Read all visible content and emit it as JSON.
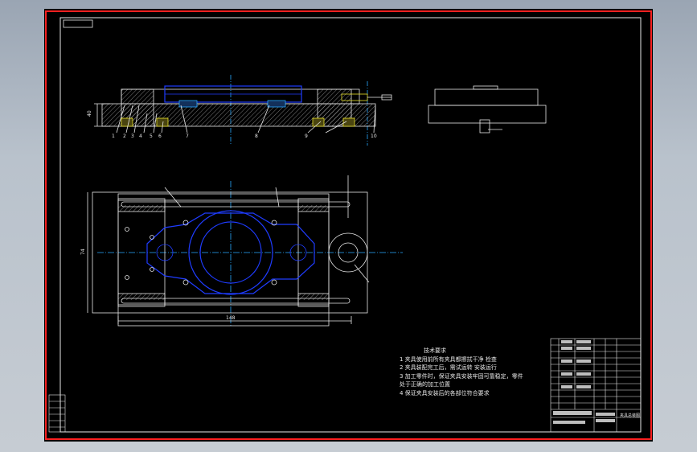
{
  "drawing": {
    "colors": {
      "background": "#000000",
      "border": "#ff2020",
      "lines": "#e8e8e8",
      "part": "#1f3cff",
      "centerline": "#29a8ff",
      "highlight": "#e8e02a"
    },
    "front_view": {
      "part_numbers": [
        "1",
        "2",
        "3",
        "4",
        "5",
        "6",
        "7",
        "8",
        "9",
        "10"
      ],
      "dims": {
        "left_height": "40"
      }
    },
    "top_view": {
      "dims": {
        "overall_length": "148",
        "left_width": "74"
      }
    },
    "notes": {
      "title": "技术要求",
      "lines": [
        "1 夹具使用前所有夹具都擦拭干净 检查",
        "2 夹具装配完工后，需试运转 安装运行",
        "3 加工零件时，保证夹具安装牢固可靠稳定，零件",
        "  处于正确的加工位置",
        "4 保证夹具安装后的各部位符合要求"
      ]
    },
    "title_block": {
      "drawing_name": "夹具总装图"
    }
  }
}
